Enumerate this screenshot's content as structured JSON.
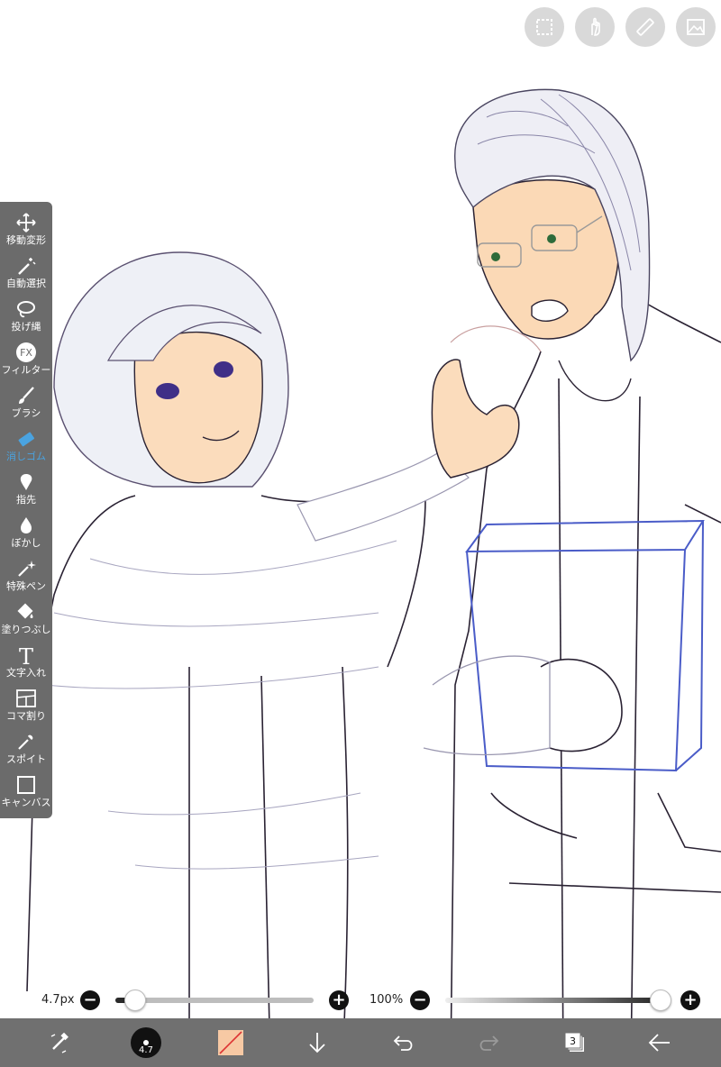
{
  "top_tools": [
    {
      "name": "selection-icon"
    },
    {
      "name": "hand-icon"
    },
    {
      "name": "ruler-icon"
    },
    {
      "name": "image-icon"
    }
  ],
  "toolbar": {
    "items": [
      {
        "label": "移動変形",
        "icon": "move-icon"
      },
      {
        "label": "自動選択",
        "icon": "magic-wand-icon"
      },
      {
        "label": "投げ縄",
        "icon": "lasso-icon"
      },
      {
        "label": "フィルター",
        "icon": "fx-icon",
        "icon_text": "FX"
      },
      {
        "label": "ブラシ",
        "icon": "brush-icon"
      },
      {
        "label": "消しゴム",
        "icon": "eraser-icon",
        "active": true
      },
      {
        "label": "指先",
        "icon": "finger-icon"
      },
      {
        "label": "ぼかし",
        "icon": "blur-icon"
      },
      {
        "label": "特殊ペン",
        "icon": "special-pen-icon"
      },
      {
        "label": "塗りつぶし",
        "icon": "fill-icon"
      },
      {
        "label": "文字入れ",
        "icon": "text-icon",
        "icon_text": "T"
      },
      {
        "label": "コマ割り",
        "icon": "frame-divider-icon"
      },
      {
        "label": "スポイト",
        "icon": "eyedropper-icon"
      },
      {
        "label": "キャンバス",
        "icon": "canvas-icon"
      }
    ]
  },
  "brush_size": {
    "value_label": "4.7px",
    "minus": "−",
    "plus": "+",
    "level": 0.04
  },
  "opacity": {
    "value_label": "100%",
    "minus": "−",
    "plus": "+",
    "level": 1.0
  },
  "bottom_bar": {
    "brush_preview_label": "4.7",
    "layers_count": "3"
  },
  "colors": {
    "toolbar_bg": "#6b6b6b",
    "bottom_bg": "#707070",
    "active_tool": "#4aa3e0",
    "current_color": "#f7c9a4",
    "skin": "#f9d9b8",
    "box_outline": "#4a5cc8"
  }
}
